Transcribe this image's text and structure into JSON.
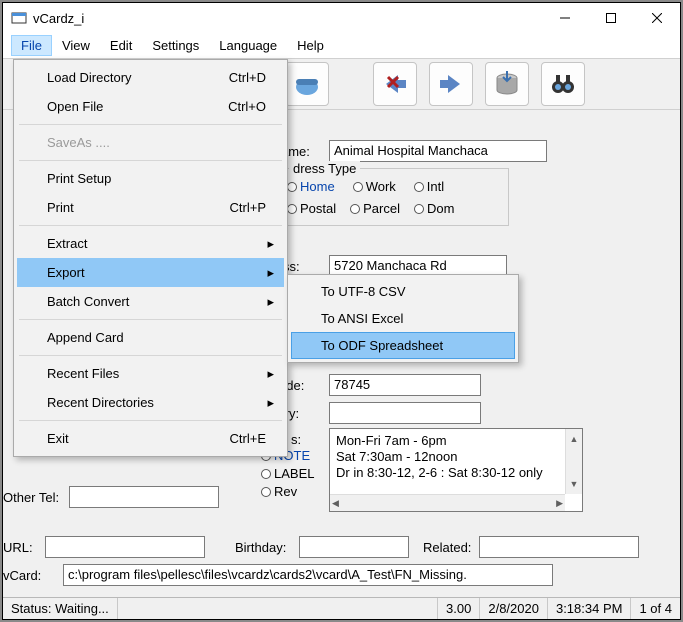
{
  "window": {
    "title": "vCardz_i"
  },
  "titlebar_controls": {
    "min_title": "Minimize",
    "max_title": "Maximize",
    "close_title": "Close"
  },
  "menubar": {
    "items": [
      "File",
      "View",
      "Edit",
      "Settings",
      "Language",
      "Help"
    ],
    "active_index": 0
  },
  "file_menu": {
    "items": [
      {
        "label": "Load Directory",
        "accel": "Ctrl+D"
      },
      {
        "label": "Open File",
        "accel": "Ctrl+O"
      },
      {
        "sep": true
      },
      {
        "label": "SaveAs ....",
        "disabled": true
      },
      {
        "sep": true
      },
      {
        "label": "Print Setup"
      },
      {
        "label": "Print",
        "accel": "Ctrl+P"
      },
      {
        "sep": true
      },
      {
        "label": "Extract",
        "submenu": true
      },
      {
        "label": "Export",
        "submenu": true,
        "selected": true
      },
      {
        "label": "Batch Convert",
        "submenu": true
      },
      {
        "sep": true
      },
      {
        "label": "Append Card"
      },
      {
        "sep": true
      },
      {
        "label": "Recent Files",
        "submenu": true
      },
      {
        "label": "Recent Directories",
        "submenu": true
      },
      {
        "sep": true
      },
      {
        "label": "Exit",
        "accel": "Ctrl+E"
      }
    ]
  },
  "export_submenu": {
    "items": [
      {
        "label": "To UTF-8 CSV"
      },
      {
        "label": "To ANSI Excel"
      },
      {
        "label": "To ODF Spreadsheet",
        "selected": true
      }
    ]
  },
  "form": {
    "name_label": "ame:",
    "name_value": "Animal Hospital Manchaca",
    "address_type_label": "dress Type",
    "addr_types": {
      "home": "Home",
      "work": "Work",
      "intl": "Intl",
      "postal": "Postal",
      "parcel": "Parcel",
      "dom": "Dom"
    },
    "address_label_suffix": "ss:",
    "address_value": "5720 Manchaca Rd",
    "code_label_suffix": "ode:",
    "code_value": "78745",
    "country_label_suffix": "try:",
    "country_value": "",
    "s_label_suffix": "s:",
    "note_label": "NOTE",
    "label_label": "LABEL",
    "rev_label": "Rev",
    "hours_lines": [
      "Mon-Fri 7am - 6pm",
      "Sat 7:30am - 12noon",
      "",
      "Dr in 8:30-12, 2-6 : Sat 8:30-12 only"
    ],
    "other_tel_label": "Other Tel:",
    "url_label": "URL:",
    "birthday_label": "Birthday:",
    "related_label": "Related:",
    "vcard_label": "vCard:",
    "vcard_value": "c:\\program files\\pellesc\\files\\vcardz\\cards2\\vcard\\A_Test\\FN_Missing."
  },
  "status": {
    "text": "Status: Waiting...",
    "version": "3.00",
    "date": "2/8/2020",
    "time": "3:18:34 PM",
    "pos": "1 of 4"
  },
  "toolbar_icons": [
    "phone-icon",
    "delete-arrow-icon",
    "forward-arrow-icon",
    "drive-icon",
    "binoculars-icon"
  ]
}
